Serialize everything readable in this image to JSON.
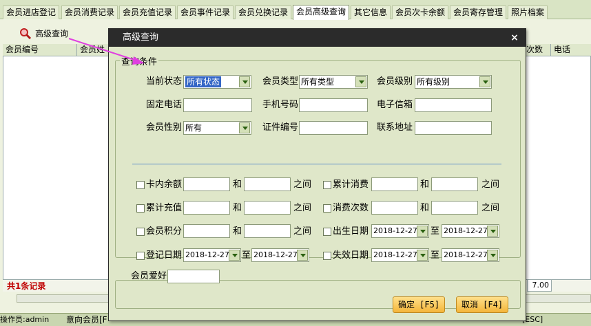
{
  "tabs": [
    {
      "label": "会员进店登记"
    },
    {
      "label": "会员消费记录"
    },
    {
      "label": "会员充值记录"
    },
    {
      "label": "会员事件记录"
    },
    {
      "label": "会员兑换记录"
    },
    {
      "label": "会员高级查询",
      "active": true
    },
    {
      "label": "其它信息"
    },
    {
      "label": "会员次卡余额"
    },
    {
      "label": "会员寄存管理"
    },
    {
      "label": "照片档案"
    }
  ],
  "toolbar": {
    "advanced_query_label": "高级查询",
    "icon": "magnifier-icon"
  },
  "grid": {
    "columns": [
      "会员编号",
      "会员姓",
      "次数",
      "电话"
    ],
    "record_count": "共1条记录",
    "total_value": "7.00"
  },
  "statusbar": {
    "operator": "操作员:admin",
    "intent_member": "意向会员[F",
    "esc_hint": "[ESC]"
  },
  "dialog": {
    "title": "高级查询",
    "close_symbol": "×",
    "group_title": "查询条件",
    "labels": {
      "status": "当前状态",
      "member_type": "会员类型",
      "member_level": "会员级别",
      "fixed_phone": "固定电话",
      "mobile": "手机号码",
      "email": "电子信箱",
      "gender": "会员性别",
      "id_number": "证件编号",
      "address": "联系地址",
      "card_balance": "卡内余额",
      "total_consume": "累计消费",
      "total_recharge": "累计充值",
      "consume_count": "消费次数",
      "points": "会员积分",
      "birthday": "出生日期",
      "register_date": "登记日期",
      "expire_date": "失效日期",
      "and": "和",
      "between": "之间",
      "to": "至",
      "hobby": "会员爱好"
    },
    "selects": {
      "status": "所有状态",
      "member_type": "所有类型",
      "member_level": "所有级别",
      "gender": "所有"
    },
    "dates": {
      "birth_from": "2018-12-27",
      "birth_to": "2018-12-27",
      "reg_from": "2018-12-27",
      "reg_to": "2018-12-27",
      "exp_from": "2018-12-27",
      "exp_to": "2018-12-27"
    },
    "buttons": {
      "ok": "确定 [F5]",
      "cancel": "取消 [F4]"
    }
  }
}
